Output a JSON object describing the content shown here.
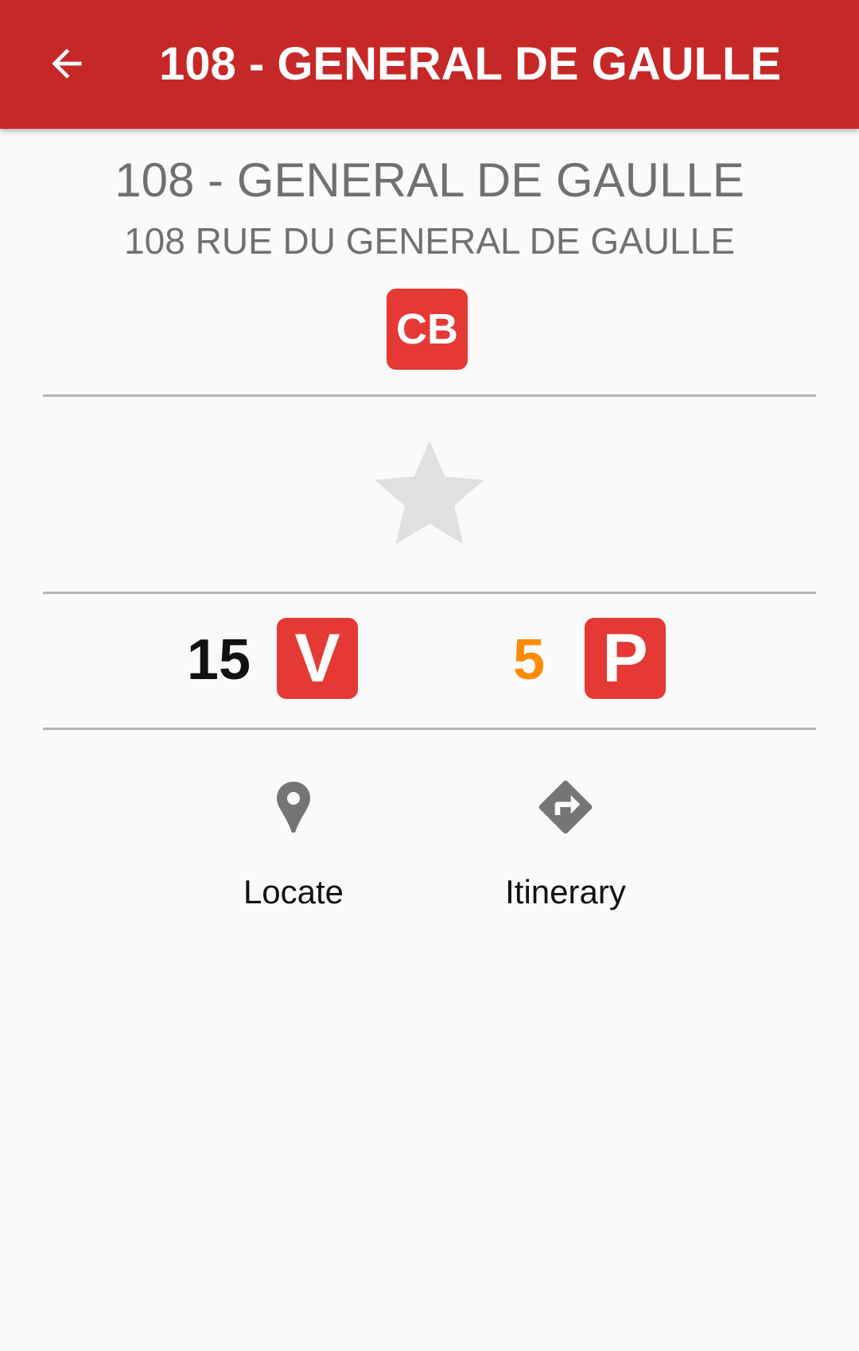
{
  "appbar": {
    "title": "108 - GENERAL DE GAULLE",
    "back_icon": "arrow-left-icon",
    "color": "#c62828"
  },
  "station": {
    "name": "108 - GENERAL DE GAULLE",
    "address": "108 RUE DU GENERAL DE GAULLE",
    "payment_badge": "CB"
  },
  "favorite": {
    "icon": "star-icon",
    "active": false
  },
  "availability": {
    "bikes_count": "15",
    "bikes_badge": "V",
    "bikes_color": "#111111",
    "parking_count": "5",
    "parking_badge": "P",
    "parking_color": "#fb8c00",
    "badge_color": "#e53935"
  },
  "actions": [
    {
      "label": "Locate",
      "icon": "map-pin-icon"
    },
    {
      "label": "Itinerary",
      "icon": "directions-icon"
    }
  ]
}
